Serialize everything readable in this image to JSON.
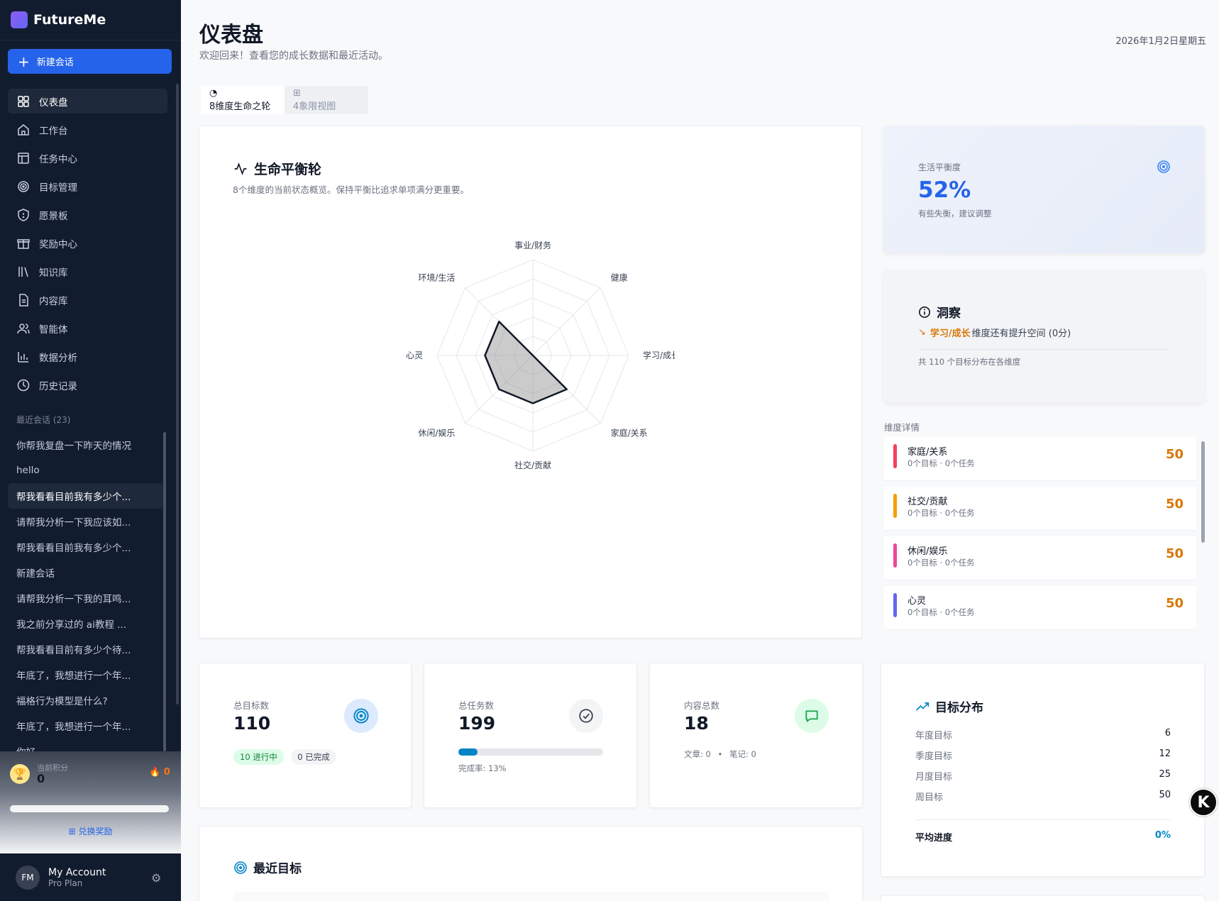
{
  "app": {
    "name": "FutureMe"
  },
  "sidebar": {
    "new_chat": "新建会话",
    "nav": [
      {
        "label": "仪表盘",
        "icon": "grid-icon"
      },
      {
        "label": "工作台",
        "icon": "home-icon"
      },
      {
        "label": "任务中心",
        "icon": "layout-icon"
      },
      {
        "label": "目标管理",
        "icon": "target-icon"
      },
      {
        "label": "愿景板",
        "icon": "shield-icon"
      },
      {
        "label": "奖励中心",
        "icon": "gift-icon"
      },
      {
        "label": "知识库",
        "icon": "library-icon"
      },
      {
        "label": "内容库",
        "icon": "file-icon"
      },
      {
        "label": "智能体",
        "icon": "users-icon"
      },
      {
        "label": "数据分析",
        "icon": "bar-chart-icon"
      },
      {
        "label": "历史记录",
        "icon": "clock-icon"
      }
    ],
    "recent_title": "最近会话 (23)",
    "recent": [
      "你帮我复盘一下昨天的情况",
      "hello",
      "帮我看看目前我有多少个...",
      "请帮我分析一下我应该如...",
      "帮我看看目前我有多少个...",
      "新建会话",
      "请帮我分析一下我的耳鸣...",
      "我之前分享过的 ai教程 ...",
      "帮我看看目前有多少个待...",
      "年底了，我想进行一个年...",
      "福格行为模型是什么?",
      "年底了，我想进行一个年...",
      "你好"
    ],
    "points": {
      "label": "当前积分",
      "value": "0",
      "streak": "0",
      "redeem": "兑换奖励"
    },
    "account": {
      "initials": "FM",
      "name": "My Account",
      "plan": "Pro Plan"
    }
  },
  "header": {
    "title": "仪表盘",
    "subtitle": "欢迎回来！查看您的成长数据和最近活动。",
    "date": "2026年1月2日星期五"
  },
  "tabs": [
    {
      "label": "8维度生命之轮",
      "icon": "pie-icon"
    },
    {
      "label": "4象限视图",
      "icon": "quadrant-icon"
    }
  ],
  "wheel": {
    "title": "生命平衡轮",
    "subtitle": "8个维度的当前状态概览。保持平衡比追求单项满分更重要。"
  },
  "chart_data": {
    "type": "radar",
    "categories": [
      "事业/财务",
      "健康",
      "学习/成长",
      "家庭/关系",
      "社交/贡献",
      "休闲/娱乐",
      "心灵",
      "环境/生活"
    ],
    "values": [
      0,
      0,
      0,
      50,
      50,
      50,
      50,
      50
    ],
    "ylim": [
      0,
      100
    ],
    "grid": true
  },
  "balance": {
    "label": "生活平衡度",
    "value": "52%",
    "hint": "有些失衡，建议调整"
  },
  "insight": {
    "title": "洞察",
    "highlight": "学习/成长",
    "text": "维度还有提升空间 (0分)",
    "count": "共 110 个目标分布在各维度"
  },
  "dimensions": {
    "title": "维度详情",
    "items": [
      {
        "name": "家庭/关系",
        "meta": "0个目标 · 0个任务",
        "score": "50",
        "color": "#f43f5e"
      },
      {
        "name": "社交/贡献",
        "meta": "0个目标 · 0个任务",
        "score": "50",
        "color": "#f59e0b"
      },
      {
        "name": "休闲/娱乐",
        "meta": "0个目标 · 0个任务",
        "score": "50",
        "color": "#ec4899"
      },
      {
        "name": "心灵",
        "meta": "0个目标 · 0个任务",
        "score": "50",
        "color": "#6366f1"
      }
    ]
  },
  "stats": {
    "goals": {
      "label": "总目标数",
      "value": "110",
      "in_progress": "10 进行中",
      "done": "0 已完成"
    },
    "tasks": {
      "label": "总任务数",
      "value": "199",
      "rate": "完成率: 13%",
      "progress": 0.13
    },
    "content": {
      "label": "内容总数",
      "value": "18",
      "articles": "文章: 0",
      "notes": "笔记: 0"
    }
  },
  "goal_dist": {
    "title": "目标分布",
    "rows": [
      {
        "k": "年度目标",
        "v": "6"
      },
      {
        "k": "季度目标",
        "v": "12"
      },
      {
        "k": "月度目标",
        "v": "25"
      },
      {
        "k": "周目标",
        "v": "50"
      }
    ],
    "avg_label": "平均进度",
    "avg_value": "0%"
  },
  "recent_goals": {
    "title": "最近目标"
  },
  "floating": {
    "label": "K"
  }
}
